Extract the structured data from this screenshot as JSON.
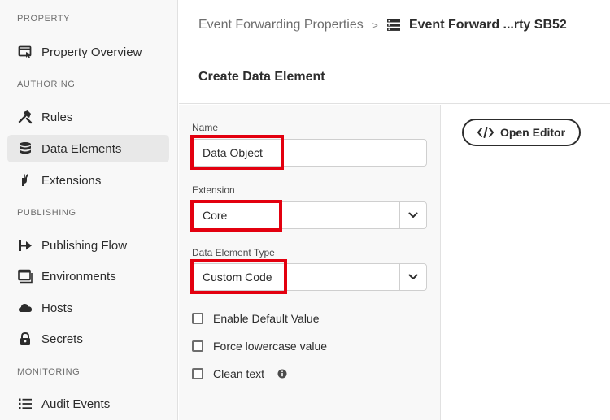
{
  "sidebar": {
    "sections": {
      "property": "PROPERTY",
      "authoring": "AUTHORING",
      "publishing": "PUBLISHING",
      "monitoring": "MONITORING"
    },
    "items": {
      "property_overview": "Property Overview",
      "rules": "Rules",
      "data_elements": "Data Elements",
      "extensions": "Extensions",
      "publishing_flow": "Publishing Flow",
      "environments": "Environments",
      "hosts": "Hosts",
      "secrets": "Secrets",
      "audit_events": "Audit Events"
    },
    "active_item": "data_elements"
  },
  "header": {
    "breadcrumb_parent": "Event Forwarding Properties",
    "breadcrumb_separator": ">",
    "breadcrumb_current": "Event Forward ...rty SB52"
  },
  "page": {
    "title": "Create Data Element"
  },
  "form": {
    "name_label": "Name",
    "name_value": "Data Object",
    "extension_label": "Extension",
    "extension_value": "Core",
    "type_label": "Data Element Type",
    "type_value": "Custom Code",
    "checkboxes": {
      "enable_default": "Enable Default Value",
      "force_lowercase": "Force lowercase value",
      "clean_text": "Clean text"
    }
  },
  "editor": {
    "open_editor_label": "Open Editor"
  },
  "colors": {
    "highlight": "#e3000f",
    "text": "#2c2c2c",
    "muted": "#6e6e6e"
  }
}
